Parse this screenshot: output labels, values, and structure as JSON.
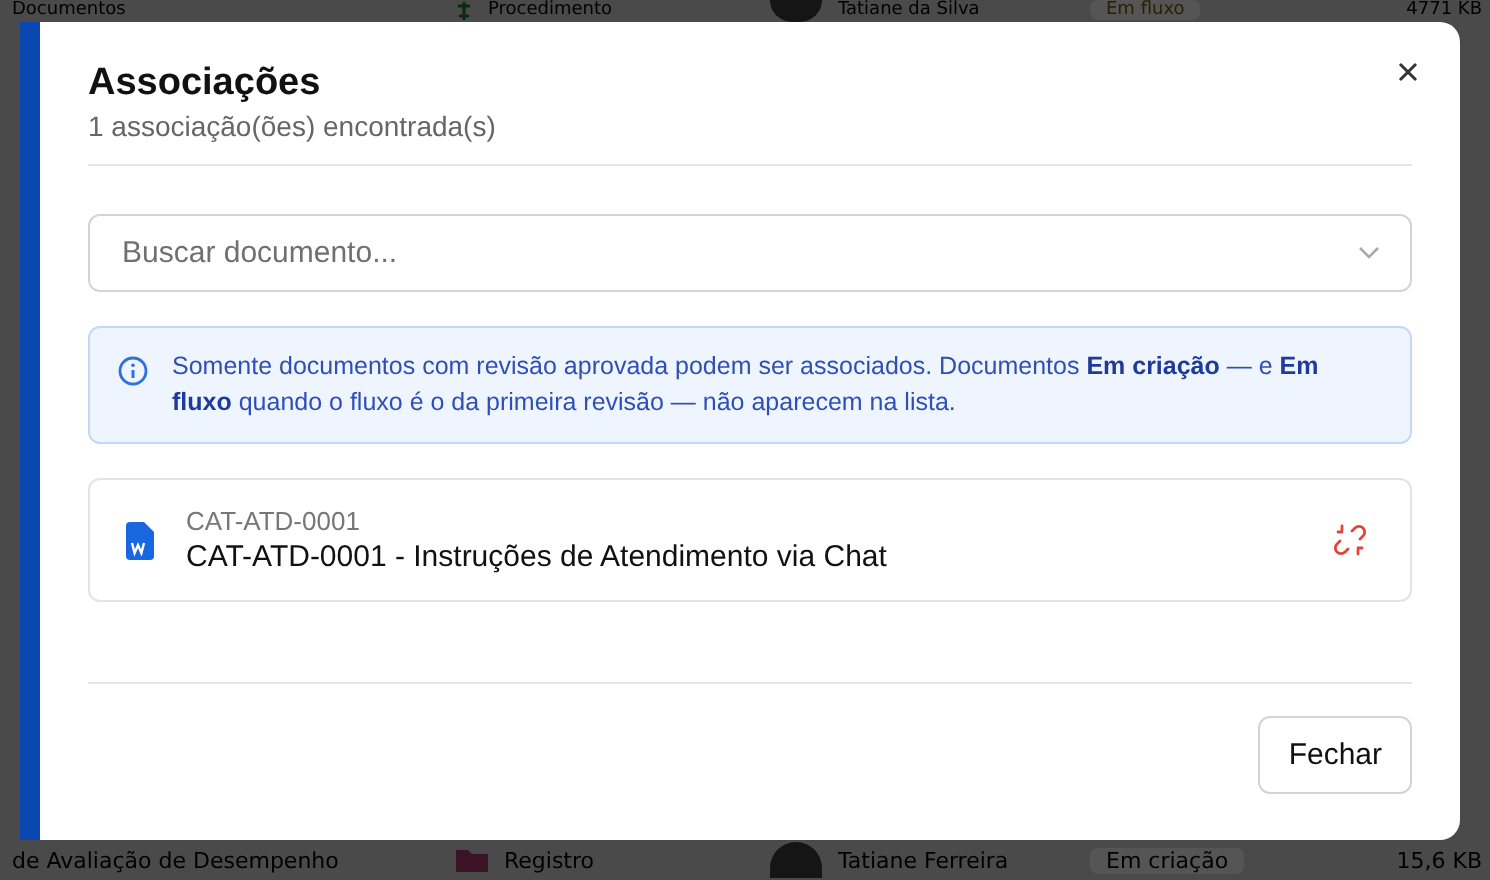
{
  "background": {
    "top_row": {
      "name": "Documentos",
      "type": "Procedimento",
      "owner": "Tatiane da Silva",
      "status": "Em fluxo",
      "size": "4771 KB"
    },
    "bottom_row": {
      "name": "de Avaliação de Desempenho",
      "type": "Registro",
      "owner": "Tatiane Ferreira",
      "status": "Em criação",
      "size": "15,6 KB"
    }
  },
  "dialog": {
    "title": "Associações",
    "subtitle": "1 associação(ões) encontrada(s)",
    "search": {
      "placeholder": "Buscar documento..."
    },
    "notice": "Somente documentos com revisão aprovada podem ser associados. Documentos **Em criação** — e **Em fluxo** quando o fluxo é o da primeira revisão — não aparecem na lista.",
    "associations": [
      {
        "code": "CAT-ATD-0001",
        "title": "CAT-ATD-0001 - Instruções de Atendimento via Chat"
      }
    ],
    "buttons": [
      "Fechar"
    ]
  }
}
